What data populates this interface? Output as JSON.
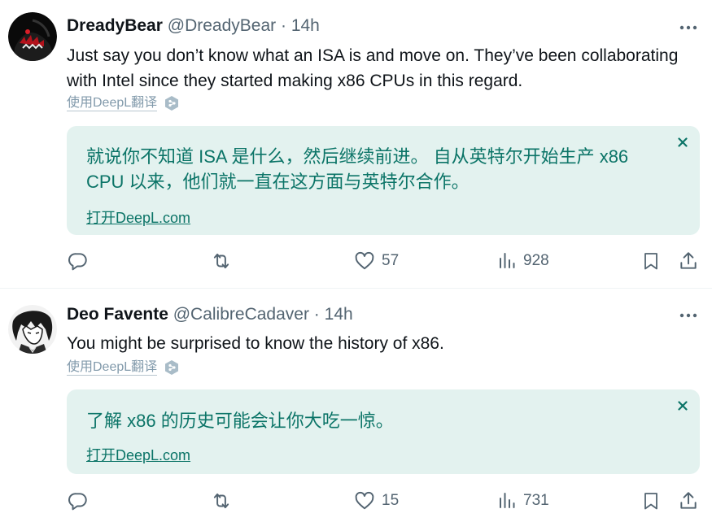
{
  "tweets": [
    {
      "display_name": "DreadyBear",
      "handle": "@DreadyBear",
      "dot": "·",
      "time": "14h",
      "text": "Just say you don’t know what an ISA is and move on. They’ve been collaborating with Intel since they started making x86 CPUs in this regard.",
      "translate_label": "使用DeepL翻译",
      "translation": "就说你不知道 ISA 是什么，然后继续前进。 自从英特尔开始生产 x86 CPU 以来，他们就一直在这方面与英特尔合作。",
      "open_link": "打开DeepL.com",
      "likes": "57",
      "views": "928"
    },
    {
      "display_name": "Deo Favente",
      "handle": "@CalibreCadaver",
      "dot": "·",
      "time": "14h",
      "text": "You might be surprised to know the history of x86.",
      "translate_label": "使用DeepL翻译",
      "translation": "了解 x86 的历史可能会让你大吃一惊。",
      "open_link": "打开DeepL.com",
      "likes": "15",
      "views": "731"
    }
  ],
  "icons": {
    "more": "more-dots-icon",
    "close": "close-icon",
    "reply": "reply-icon",
    "retweet": "retweet-icon",
    "like": "heart-icon",
    "views": "views-bar-chart-icon",
    "bookmark": "bookmark-icon",
    "share": "share-icon",
    "deepl": "deepl-logo-icon"
  },
  "colors": {
    "text": "#0f1419",
    "secondary": "#536471",
    "deepl_bg": "#e3f2ef",
    "deepl_text": "#0b7467",
    "translate_label": "#829aab"
  }
}
